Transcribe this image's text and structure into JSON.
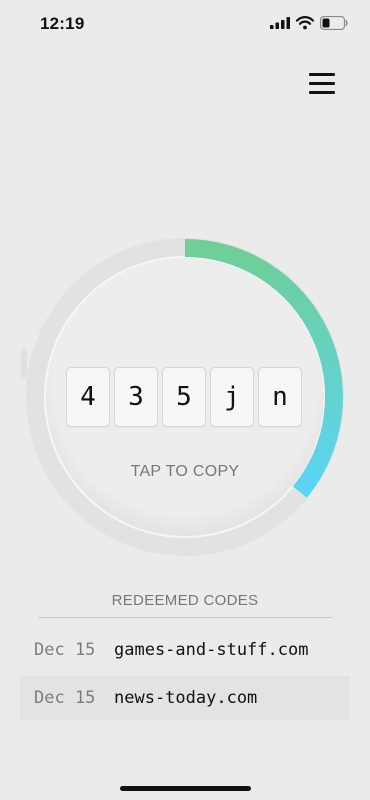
{
  "status_bar": {
    "time": "12:19",
    "icons": [
      "signal-icon",
      "wifi-icon",
      "battery-icon"
    ]
  },
  "header": {
    "menu_icon": "hamburger-menu-icon"
  },
  "timer": {
    "progress_fraction": 0.36,
    "gradient_start": "#6fcf97",
    "gradient_end": "#5ad4f6"
  },
  "code": {
    "chars": [
      "4",
      "3",
      "5",
      "j",
      "n"
    ],
    "tap_label": "TAP TO COPY"
  },
  "redeemed": {
    "title": "REDEEMED CODES",
    "items": [
      {
        "date": "Dec 15",
        "site": "games-and-stuff.com"
      },
      {
        "date": "Dec 15",
        "site": "news-today.com"
      }
    ]
  },
  "colors": {
    "background": "#ebebeb",
    "text_primary": "#111111",
    "text_muted": "#777777",
    "row_highlight": "#e3e3e3"
  }
}
